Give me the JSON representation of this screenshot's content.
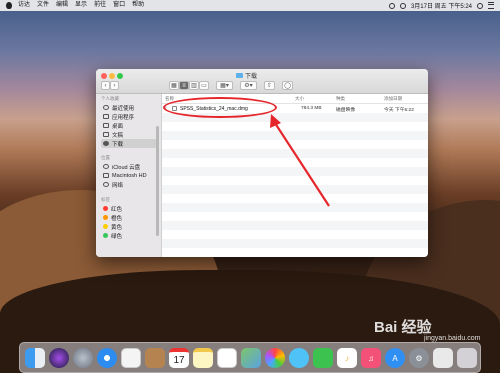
{
  "menubar": {
    "items": [
      "访达",
      "文件",
      "编辑",
      "显示",
      "前往",
      "窗口",
      "帮助"
    ],
    "clock": "3月17日 周五 下午5:24"
  },
  "window": {
    "title": "下载",
    "nav_back": "‹",
    "nav_forward": "›"
  },
  "sidebar": {
    "favorites_header": "个人收藏",
    "favorites": [
      "最近使用",
      "应用程序",
      "桌面",
      "文稿",
      "下载"
    ],
    "locations_header": "位置",
    "locations": [
      "iCloud 云盘",
      "Macintosh HD",
      "网络"
    ],
    "tags_header": "标签",
    "tags": [
      {
        "label": "红色",
        "color": "#ff3b30"
      },
      {
        "label": "橙色",
        "color": "#ff9500"
      },
      {
        "label": "黄色",
        "color": "#ffcc00"
      },
      {
        "label": "绿色",
        "color": "#34c759"
      }
    ]
  },
  "columns": {
    "name": "名称",
    "size": "大小",
    "kind": "种类",
    "date_added": "添加日期"
  },
  "files": [
    {
      "name": "SPSS_Statistics_24_mac.dmg",
      "size": "784.3 MB",
      "kind": "磁盘映像",
      "date_added": "今天 下午5:22"
    }
  ],
  "colors": {
    "annotation": "#e5262a",
    "selection": "#d0d0d0"
  },
  "dock": {
    "apps": [
      "finder-icon",
      "siri-icon",
      "launchpad-icon",
      "safari-icon",
      "mail-icon",
      "contacts-icon",
      "calendar-icon",
      "notes-icon",
      "reminders-icon",
      "maps-icon",
      "photos-icon",
      "messages-icon",
      "facetime-icon",
      "music-icon",
      "appstore-icon",
      "preferences-icon",
      "preview-icon",
      "trash-icon"
    ],
    "calendar_day": "17"
  },
  "watermark": {
    "brand": "Bai 经验",
    "url": "jingyan.baidu.com"
  }
}
